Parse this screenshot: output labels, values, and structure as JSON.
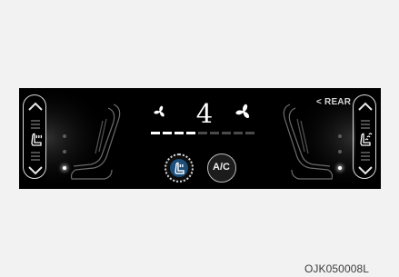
{
  "hvac": {
    "fan_speed": "4",
    "fan_bar_count": 9,
    "fan_bars_on": 4,
    "rear_label": "< REAR"
  },
  "left_seat": {
    "heat_setting": "on"
  },
  "right_seat": {
    "heat_setting": "off"
  },
  "ac_button": {
    "label": "A/C"
  },
  "icons": {
    "up": "chevron-up-icon",
    "down": "chevron-down-icon",
    "seat_heat": "seat-heater-icon",
    "seat_vent": "seat-ventilation-icon",
    "fan_small": "fan-low-icon",
    "fan_large": "fan-high-icon"
  },
  "colors": {
    "panel": "#000000",
    "page": "#f2f2f2",
    "text": "#ffffff"
  },
  "figure": {
    "code": "OJK050008L"
  }
}
